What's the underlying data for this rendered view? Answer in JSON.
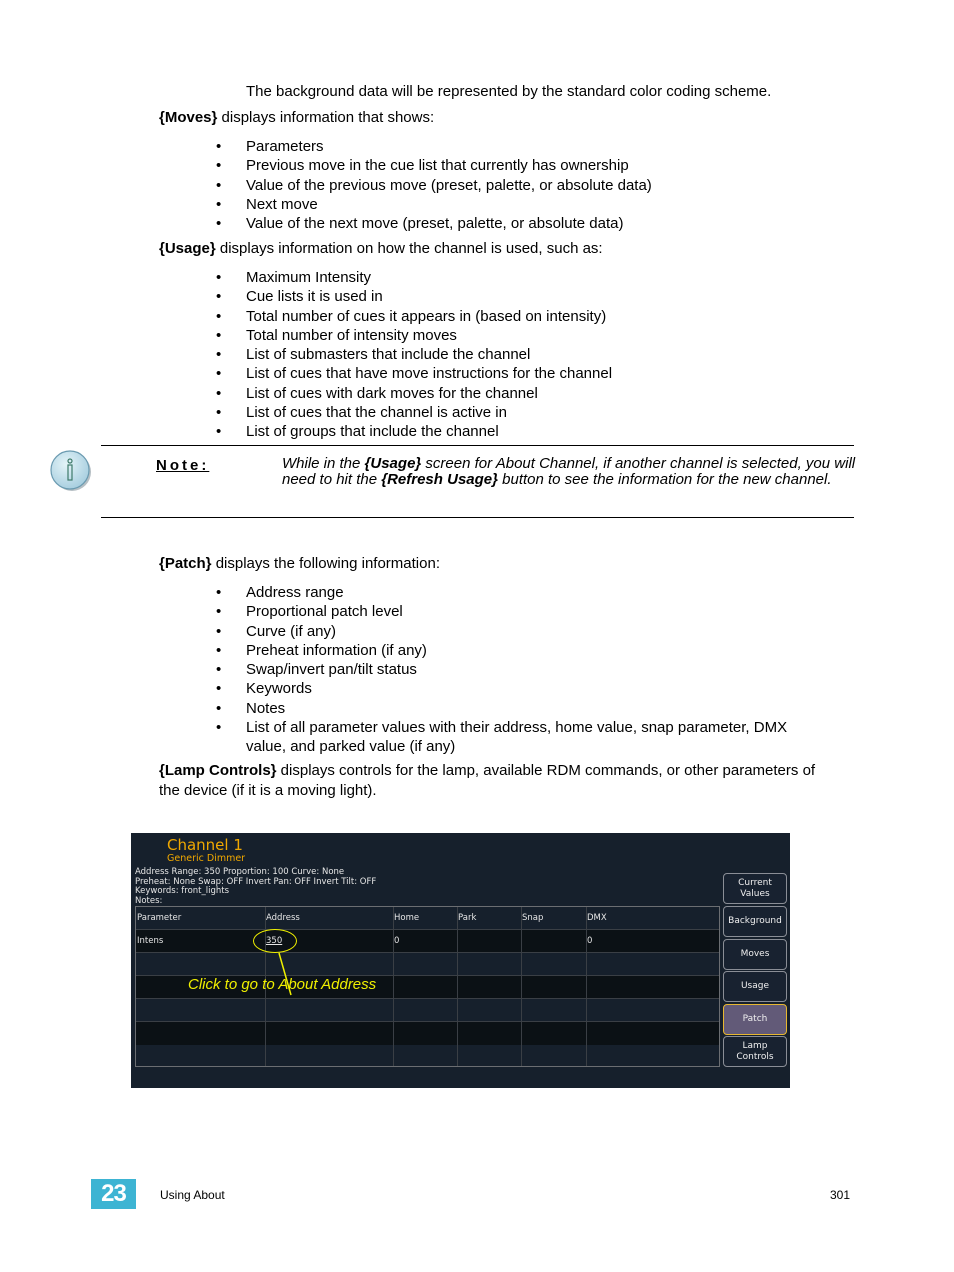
{
  "intro_line": "The background data will be represented by the standard color coding scheme.",
  "moves_section": {
    "keyword": "{Moves}",
    "text": " displays information that shows:",
    "items": [
      "Parameters",
      "Previous move in the cue list that currently has ownership",
      "Value of the previous move (preset, palette, or absolute data)",
      "Next move",
      "Value of the next move (preset, palette, or absolute data)"
    ]
  },
  "usage_section": {
    "keyword": "{Usage}",
    "text": " displays information on how the channel is used, such as:",
    "items": [
      "Maximum Intensity",
      "Cue lists it is used in",
      "Total number of cues it appears in (based on intensity)",
      "Total number of intensity moves",
      "List of submasters that include the channel",
      "List of cues that have move instructions for the channel",
      "List of cues with dark moves for the channel",
      "List of cues that the channel is active in",
      "List of groups that include the channel"
    ]
  },
  "note": {
    "icon": "info-icon",
    "label": "Note:",
    "text_parts": [
      "While in the ",
      "{Usage}",
      " screen for About Channel, if another channel is selected, you will need to hit the ",
      "{Refresh Usage}",
      " button to see the information for the new channel."
    ]
  },
  "patch_section": {
    "keyword": "{Patch}",
    "text": " displays the following information:",
    "items": [
      "Address range",
      "Proportional patch level",
      "Curve (if any)",
      "Preheat information (if any)",
      "Swap/invert pan/tilt status",
      "Keywords",
      "Notes",
      "List of all parameter values with their address, home value, snap parameter, DMX",
      "value, and parked value (if any)"
    ]
  },
  "lamp_section": {
    "keyword": "{Lamp Controls}",
    "text_line1": " displays controls for the lamp, available RDM commands, or other parameters of",
    "text_line2": "the device (if it is a moving light)."
  },
  "console": {
    "channel_title": "Channel 1",
    "channel_subtitle": "Generic Dimmer",
    "info_lines": [
      "Address Range: 350   Proportion: 100   Curve: None",
      "Preheat: None   Swap: OFF   Invert Pan: OFF   Invert Tilt: OFF",
      "Keywords: front_lights",
      "Notes:"
    ],
    "table": {
      "headers": [
        "Parameter",
        "Address",
        "Home",
        "Park",
        "Snap",
        "DMX"
      ],
      "rows": [
        [
          "Intens",
          "350",
          "0",
          "",
          "",
          "0"
        ]
      ]
    },
    "buttons": [
      {
        "label": "Current Values",
        "active": false
      },
      {
        "label": "Background",
        "active": false
      },
      {
        "label": "Moves",
        "active": false
      },
      {
        "label": "Usage",
        "active": false
      },
      {
        "label": "Patch",
        "active": true
      },
      {
        "label": "Lamp Controls",
        "active": false
      }
    ],
    "callout": "Click to go to About Address",
    "colors": {
      "title": "#f0a800",
      "callout": "#f0f000",
      "active_button_bg": "#625a78",
      "active_button_border": "#e8b830",
      "background": "#16202c"
    }
  },
  "footer": {
    "chapter_number": "23",
    "chapter_title": "Using About",
    "page_number": "301",
    "badge_color": "#3db4d3"
  }
}
